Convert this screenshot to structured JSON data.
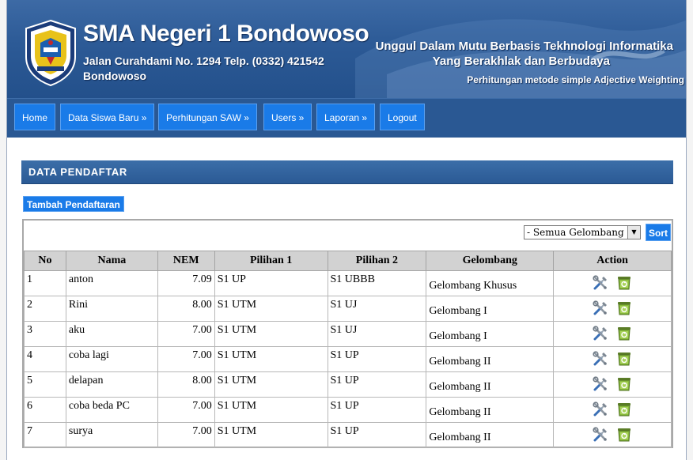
{
  "header": {
    "school_name": "SMA Negeri 1 Bondowoso",
    "address": "Jalan Curahdami No. 1294 Telp. (0332) 421542 Bondowoso",
    "tagline_1": "Unggul Dalam Mutu Berbasis Tekhnologi Informatika",
    "tagline_2": "Yang Berakhlak dan Berbudaya",
    "tagline_3": "Perhitungan metode simple Adjective Weighting"
  },
  "nav": {
    "home": "Home",
    "data_siswa": "Data Siswa Baru »",
    "perhitungan": "Perhitungan SAW »",
    "users": "Users »",
    "laporan": "Laporan »",
    "logout": "Logout"
  },
  "main": {
    "section_title": "DATA PENDAFTAR",
    "add_button": "Tambah Pendaftaran",
    "filter_selected": "- Semua Gelombang -",
    "sort_button": "Sort"
  },
  "table": {
    "headers": {
      "no": "No",
      "nama": "Nama",
      "nem": "NEM",
      "pilihan1": "Pilihan 1",
      "pilihan2": "Pilihan 2",
      "gelombang": "Gelombang",
      "action": "Action"
    },
    "rows": [
      {
        "no": "1",
        "nama": "anton",
        "nem": "7.09",
        "pilihan1": "S1 UP",
        "pilihan2": "S1 UBBB",
        "gelombang": "Gelombang Khusus"
      },
      {
        "no": "2",
        "nama": "Rini",
        "nem": "8.00",
        "pilihan1": "S1 UTM",
        "pilihan2": "S1 UJ",
        "gelombang": "Gelombang I"
      },
      {
        "no": "3",
        "nama": "aku",
        "nem": "7.00",
        "pilihan1": "S1 UTM",
        "pilihan2": "S1 UJ",
        "gelombang": "Gelombang I"
      },
      {
        "no": "4",
        "nama": "coba lagi",
        "nem": "7.00",
        "pilihan1": "S1 UTM",
        "pilihan2": "S1 UP",
        "gelombang": "Gelombang II"
      },
      {
        "no": "5",
        "nama": "delapan",
        "nem": "8.00",
        "pilihan1": "S1 UTM",
        "pilihan2": "S1 UP",
        "gelombang": "Gelombang II"
      },
      {
        "no": "6",
        "nama": "coba beda PC",
        "nem": "7.00",
        "pilihan1": "S1 UTM",
        "pilihan2": "S1 UP",
        "gelombang": "Gelombang II"
      },
      {
        "no": "7",
        "nama": "surya",
        "nem": "7.00",
        "pilihan1": "S1 UTM",
        "pilihan2": "S1 UP",
        "gelombang": "Gelombang II"
      }
    ]
  },
  "icons": {
    "edit": "wrench-screwdriver-icon",
    "delete": "recycle-bin-icon"
  },
  "colors": {
    "header_blue": "#2c5a96",
    "button_blue": "#1a7be8",
    "table_header_gray": "#d2d2d2"
  }
}
